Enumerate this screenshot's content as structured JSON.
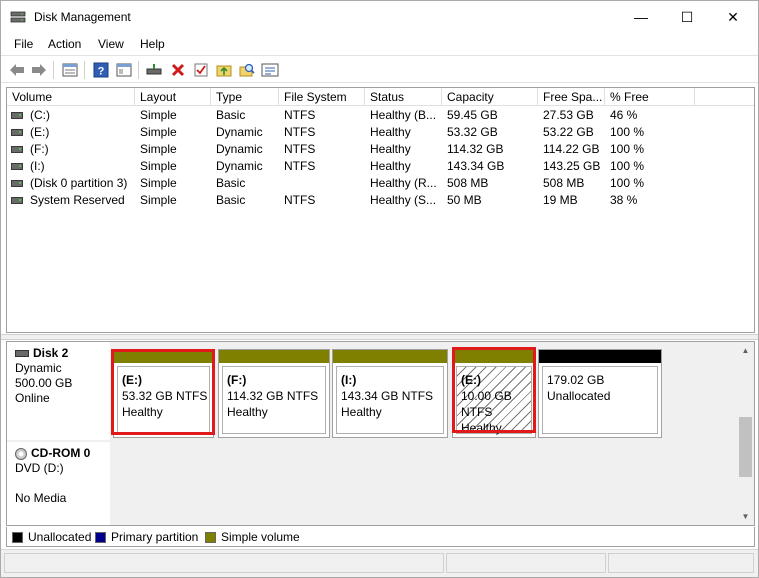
{
  "window": {
    "title": "Disk Management",
    "minimize_glyph": "—",
    "maximize_glyph": "☐",
    "close_glyph": "✕"
  },
  "menu": [
    {
      "label": "File"
    },
    {
      "label": "Action"
    },
    {
      "label": "View"
    },
    {
      "label": "Help"
    }
  ],
  "toolbar": {
    "icons": [
      "back-icon",
      "forward-icon",
      "properties-view-icon",
      "help-icon",
      "console-view-icon",
      "connect-drive-icon",
      "delete-icon",
      "check-icon",
      "folder-up-icon",
      "search-folder-icon",
      "settings-list-icon"
    ]
  },
  "volume_list": {
    "columns": [
      "Volume",
      "Layout",
      "Type",
      "File System",
      "Status",
      "Capacity",
      "Free Spa...",
      "% Free"
    ],
    "rows": [
      {
        "volume": "(C:)",
        "layout": "Simple",
        "type": "Basic",
        "fs": "NTFS",
        "status": "Healthy (B...",
        "capacity": "59.45 GB",
        "free": "27.53 GB",
        "pct": "46 %"
      },
      {
        "volume": "(E:)",
        "layout": "Simple",
        "type": "Dynamic",
        "fs": "NTFS",
        "status": "Healthy",
        "capacity": "53.32 GB",
        "free": "53.22 GB",
        "pct": "100 %"
      },
      {
        "volume": "(F:)",
        "layout": "Simple",
        "type": "Dynamic",
        "fs": "NTFS",
        "status": "Healthy",
        "capacity": "114.32 GB",
        "free": "114.22 GB",
        "pct": "100 %"
      },
      {
        "volume": "(I:)",
        "layout": "Simple",
        "type": "Dynamic",
        "fs": "NTFS",
        "status": "Healthy",
        "capacity": "143.34 GB",
        "free": "143.25 GB",
        "pct": "100 %"
      },
      {
        "volume": "(Disk 0 partition 3)",
        "layout": "Simple",
        "type": "Basic",
        "fs": "",
        "status": "Healthy (R...",
        "capacity": "508 MB",
        "free": "508 MB",
        "pct": "100 %"
      },
      {
        "volume": "System Reserved",
        "layout": "Simple",
        "type": "Basic",
        "fs": "NTFS",
        "status": "Healthy (S...",
        "capacity": "50 MB",
        "free": "19 MB",
        "pct": "38 %"
      }
    ]
  },
  "disks": {
    "disk2": {
      "name": "Disk 2",
      "type": "Dynamic",
      "size": "500.00 GB",
      "state": "Online",
      "partitions": [
        {
          "name": "(E:)",
          "size": "53.32 GB NTFS",
          "status": "Healthy",
          "bar_color": "#808000"
        },
        {
          "name": "(F:)",
          "size": "114.32 GB NTFS",
          "status": "Healthy",
          "bar_color": "#808000"
        },
        {
          "name": "(I:)",
          "size": "143.34 GB NTFS",
          "status": "Healthy",
          "bar_color": "#808000"
        },
        {
          "name": "(E:)",
          "size": "10.00 GB NTFS",
          "status": "Healthy",
          "bar_color": "#808000"
        },
        {
          "name": "",
          "size": "179.02 GB",
          "status": "Unallocated",
          "bar_color": "#000000"
        }
      ]
    },
    "cdrom0": {
      "name": "CD-ROM 0",
      "type": "DVD (D:)",
      "media": "No Media"
    }
  },
  "legend": [
    {
      "label": "Unallocated",
      "color": "#000000"
    },
    {
      "label": "Primary partition",
      "color": "#00008b"
    },
    {
      "label": "Simple volume",
      "color": "#808000"
    }
  ],
  "highlight_color": "#e01a1a"
}
